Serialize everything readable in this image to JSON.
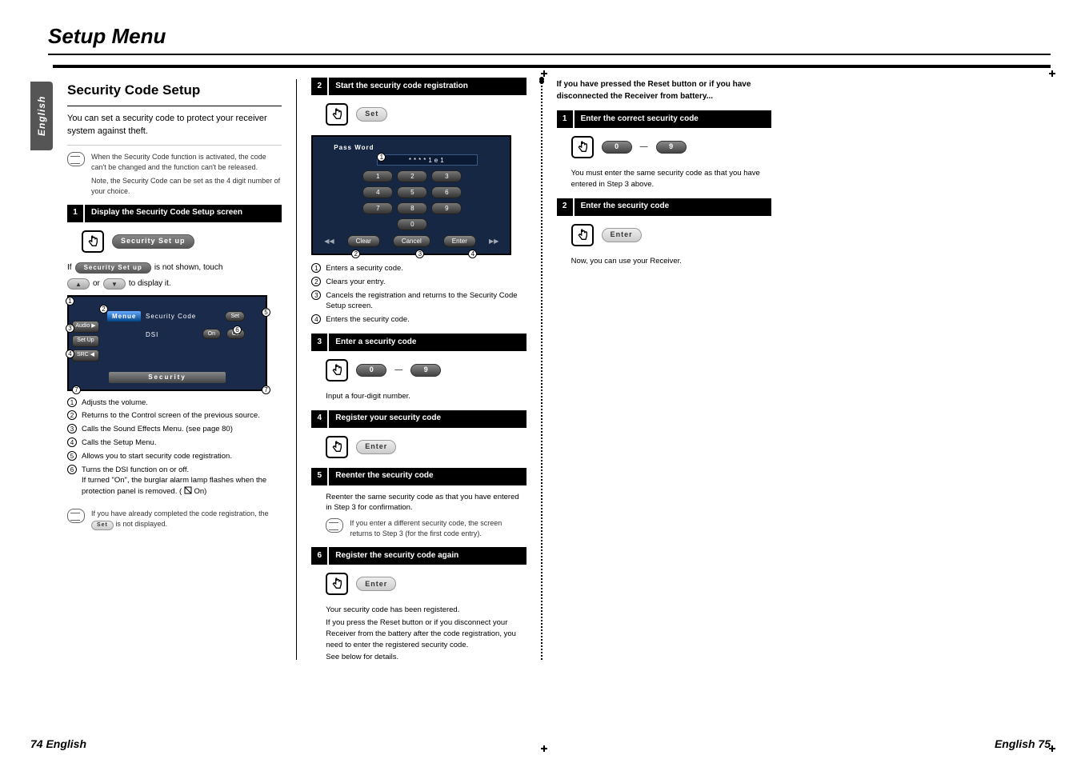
{
  "page": {
    "main_title": "Setup Menu",
    "lang_tab": "English",
    "footer_left": "74 English",
    "footer_right": "English 75"
  },
  "col1": {
    "section_title": "Security Code Setup",
    "intro": "You can set a security code to protect your receiver system against theft.",
    "note1_line1": "When the Security Code function is activated, the code can't be changed and the function can't be released.",
    "note1_line2": "Note, the Security Code can be set as the 4 digit number of your choice.",
    "step1_num": "1",
    "step1_text": "Display the Security Code Setup screen",
    "btn_security_setup": "Security Set up",
    "if_text_a": "If",
    "if_text_b": "is not shown, touch",
    "if_text_c": "or",
    "if_text_d": "to display it.",
    "arrow_up": "▲",
    "arrow_down": "▼",
    "screen1": {
      "menu_lbl": "Menue",
      "sec_code": "Security Code",
      "set": "Set",
      "dsi": "DSI",
      "on": "On",
      "off": "Off",
      "footer": "Security",
      "side_audio": "Audio ▶",
      "side_setup": "Set Up",
      "side_src": "SRC ◀"
    },
    "list": {
      "i1": "Adjusts the volume.",
      "i2": "Returns to the Control screen of the previous source.",
      "i3": "Calls the Sound Effects Menu. (see page 80)",
      "i4": "Calls the Setup Menu.",
      "i5": "Allows you to start security code registration.",
      "i6a": "Turns the DSI function on or off.",
      "i6b": "If turned \"On\", the burglar alarm lamp flashes when the protection panel is removed. (",
      "i6c": " On)"
    },
    "note2": "If you have already completed the code registration, the",
    "note2b": "is not displayed.",
    "set_chip": "Set"
  },
  "col2": {
    "step2_num": "2",
    "step2_text": "Start the security code registration",
    "btn_set": "Set",
    "keypad": {
      "passwd": "Pass Word",
      "entry": "****1e1",
      "k1": "1",
      "k2": "2",
      "k3": "3",
      "k4": "4",
      "k5": "5",
      "k6": "6",
      "k7": "7",
      "k8": "8",
      "k9": "9",
      "k0": "0",
      "clear": "Clear",
      "cancel": "Cancel",
      "enter": "Enter"
    },
    "klist": {
      "i1": "Enters a security code.",
      "i2": "Clears your entry.",
      "i3": "Cancels the registration and returns to the Security Code Setup screen.",
      "i4": "Enters the security code."
    },
    "step3_num": "3",
    "step3_text": "Enter a security code",
    "digit0": "0",
    "digit9": "9",
    "dash": "—",
    "step3_hint": "Input a four-digit number.",
    "step4_num": "4",
    "step4_text": "Register your security code",
    "btn_enter": "Enter",
    "step5_num": "5",
    "step5_text": "Reenter the security code",
    "step5_body": "Reenter the same security code as that you have entered in Step 3 for confirmation.",
    "step5_note": "If you enter a different security code, the screen returns to Step 3 (for the first code entry).",
    "step6_num": "6",
    "step6_text": "Register the security code again",
    "final_a": "Your security code has been registered.",
    "final_b": "If you press the Reset button or if you disconnect your Receiver from the battery after the code registration, you need to enter the registered security code.",
    "final_c": "See below for details."
  },
  "col3": {
    "lead": "If you have pressed the Reset button or if you have disconnected the Receiver from battery...",
    "step1_num": "1",
    "step1_text": "Enter the correct security code",
    "digit0": "0",
    "digit9": "9",
    "dash": "—",
    "body1": "You must enter the same security code as that you have entered in Step 3 above.",
    "step2_num": "2",
    "step2_text": "Enter the security code",
    "btn_enter": "Enter",
    "body2": "Now, you can use your Receiver."
  }
}
